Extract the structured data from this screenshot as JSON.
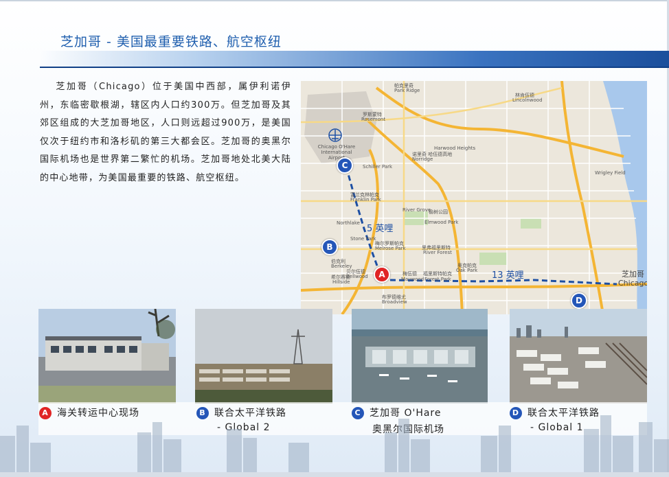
{
  "title": "芝加哥 - 美国最重要铁路、航空枢纽",
  "intro": "芝加哥（Chicago）位于美国中西部，属伊利诺伊州，东临密歇根湖，辖区内人口约300万。但芝加哥及其郊区组成的大芝加哥地区，人口则远超过900万，是美国仅次于纽约市和洛杉矶的第三大都会区。芝加哥的奥黑尔国际机场也是世界第二繁忙的机场。芝加哥地处北美大陆的中心地带，为美国最重要的铁路、航空枢纽。",
  "map": {
    "markers": [
      {
        "letter": "A",
        "color": "#e02424"
      },
      {
        "letter": "B",
        "color": "#2456b8"
      },
      {
        "letter": "C",
        "color": "#2456b8"
      },
      {
        "letter": "D",
        "color": "#2456b8"
      }
    ],
    "distance_1": "5 英哩",
    "distance_2": "13 英哩",
    "chicago_cn": "芝加哥",
    "chicago_en": "Chicago",
    "places": {
      "park_ridge_cn": "帕克里奇",
      "park_ridge": "Park Ridge",
      "rosemont_cn": "罗斯蒙特",
      "rosemont": "Rosemont",
      "lincolnwood_cn": "林肯伍德",
      "lincolnwood": "Lincolnwood",
      "ohare_airport": "Chicago O'Hare International Airport",
      "harwood_cn": "诺里奇 哈伍德高地",
      "harwood": "Harwood Heights",
      "norridge": "Norridge",
      "schiller_park": "Schiller Park",
      "franklin_park_cn": "富兰克林帕克",
      "franklin_park": "Franklin Park",
      "river_grove": "River Grove",
      "elmwood_park_cn": "榆树公园",
      "elmwood_park": "Elmwood Park",
      "northlake": "Northlake",
      "stone_park": "Stone Park",
      "melrose_park_cn": "梅尔罗斯帕克",
      "melrose_park": "Melrose Park",
      "river_forest_cn": "里弗福里斯特",
      "river_forest": "River Forest",
      "berkeley_cn": "伯克利",
      "berkeley": "Berkeley",
      "bellwood_cn": "贝尔伍德",
      "bellwood": "Bellwood",
      "hillside_cn": "希尔赛德",
      "hillside": "Hillside",
      "maywood_cn": "梅伍德",
      "maywood": "Maywood",
      "forest_park_cn": "福里斯特帕克",
      "forest_park": "Forest Park",
      "oak_park_cn": "奥克帕克",
      "oak_park": "Oak Park",
      "broadview_cn": "布罗德维尤",
      "broadview": "Broadview",
      "wrigley_field": "Wrigley Field"
    }
  },
  "photos": [
    {
      "letter": "A",
      "color": "#e02424",
      "caption": "海关转运中心现场"
    },
    {
      "letter": "B",
      "color": "#2456b8",
      "caption": "联合太平洋铁路",
      "caption2": "- Global 2"
    },
    {
      "letter": "C",
      "color": "#2456b8",
      "caption": "芝加哥 O'Hare",
      "caption2": "奥黑尔国际机场"
    },
    {
      "letter": "D",
      "color": "#2456b8",
      "caption": "联合太平洋铁路",
      "caption2": "- Global 1"
    }
  ]
}
